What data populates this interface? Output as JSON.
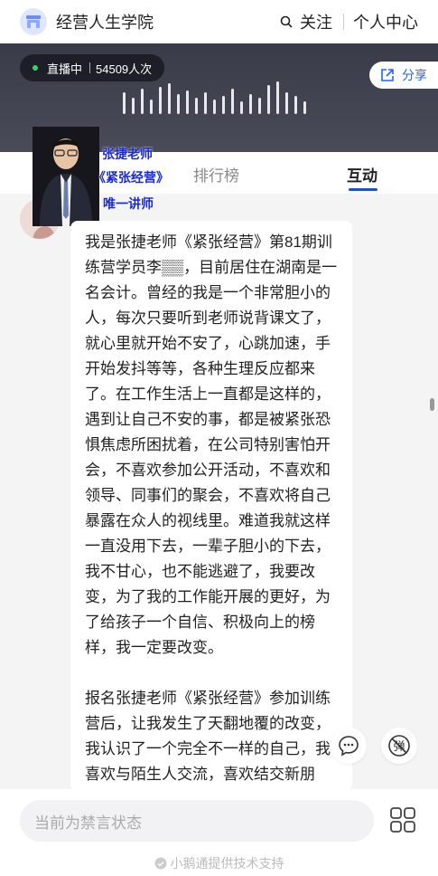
{
  "header": {
    "app_title": "经营人生学院",
    "follow_label": "关注",
    "profile_label": "个人中心"
  },
  "video": {
    "live_status": "直播中",
    "viewer_count": "54509人次",
    "share_label": "分享"
  },
  "teacher": {
    "label_line1": "张捷老师",
    "label_line2": "《紧张经营》",
    "label_line3": "唯一讲师"
  },
  "tabs": [
    {
      "label": "排行榜",
      "active": false
    },
    {
      "label": "互动",
      "active": true
    }
  ],
  "message": {
    "paragraphs": [
      "我是张捷老师《紧张经营》第81期训练营学员李▒▒，目前居住在湖南是一名会计。曾经的我是一个非常胆小的人，每次只要听到老师说背课文了，就心里就开始不安了，心跳加速，手开始发抖等等，各种生理反应都来了。在工作生活上一直都是这样的，遇到让自己不安的事，都是被紧张恐惧焦虑所困扰着，在公司特别害怕开会，不喜欢参加公开活动，不喜欢和领导、同事们的聚会，不喜欢将自己暴露在众人的视线里。难道我就这样一直没用下去，一辈子胆小的下去，我不甘心，也不能逃避了，我要改变，为了我的工作能开展的更好，为了给孩子一个自信、积极向上的榜样，我一定要改变。",
      "报名张捷老师《紧张经营》参加训练营后，让我发生了天翻地覆的改变，我认识了一个完全不一样的自己，我喜欢与陌生人交流，喜欢结交新朋友，路上见到熟人，主动上前打招呼，随便聊下家常，都很自"
    ]
  },
  "floating": {
    "danmu_label": "弹"
  },
  "bottom": {
    "input_placeholder": "当前为禁言状态",
    "powered_by": "小鹅通提供技术支持"
  },
  "colors": {
    "accent": "#1d4ed8",
    "live_dot": "#31d66b",
    "teacher_label": "#1b2bd1"
  }
}
